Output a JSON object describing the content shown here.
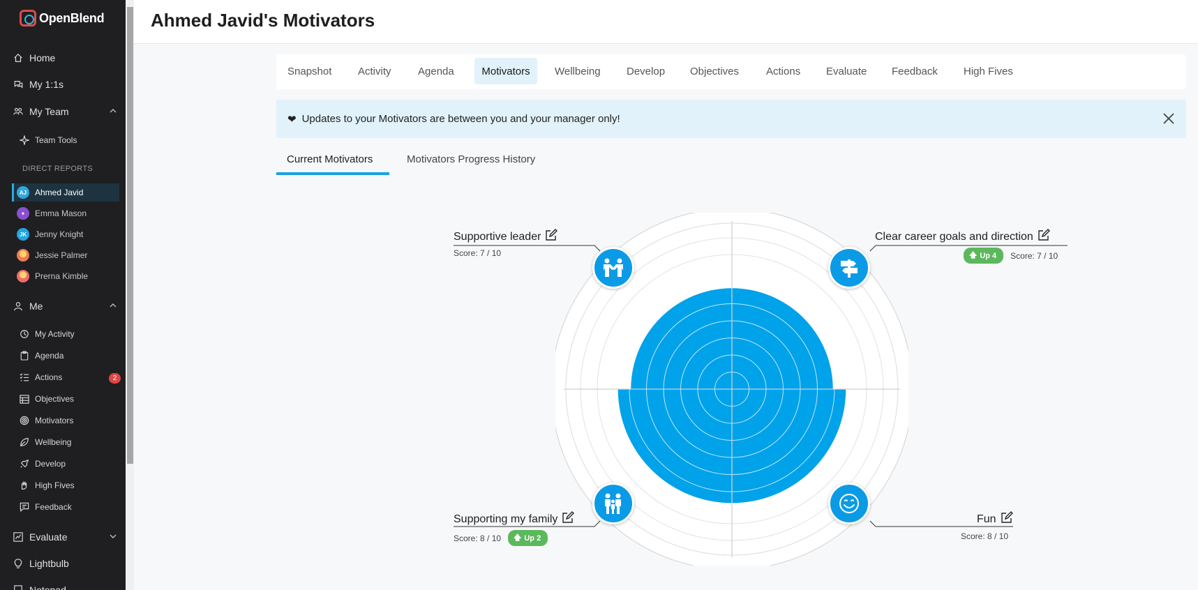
{
  "app": {
    "name": "OpenBlend"
  },
  "sidebar": {
    "home": "Home",
    "my_1_1s": "My 1:1s",
    "my_team": "My Team",
    "team_tools": "Team Tools",
    "direct_reports_label": "DIRECT REPORTS",
    "reports": [
      {
        "name": "Ahmed Javid",
        "initials": "AJ",
        "color": "#2fa8e0",
        "active": true
      },
      {
        "name": "Emma Mason",
        "initials": "",
        "color": "#8a4fd0",
        "active": false
      },
      {
        "name": "Jenny Knight",
        "initials": "JK",
        "color": "#20a6e6",
        "active": false
      },
      {
        "name": "Jessie Palmer",
        "initials": "",
        "color": "#f07a53",
        "active": false
      },
      {
        "name": "Prerna Kimble",
        "initials": "",
        "color": "#ef6c6c",
        "active": false
      }
    ],
    "me": "Me",
    "me_items": {
      "activity": "My Activity",
      "agenda": "Agenda",
      "actions": "Actions",
      "actions_count": "2",
      "objectives": "Objectives",
      "motivators": "Motivators",
      "wellbeing": "Wellbeing",
      "develop": "Develop",
      "high_fives": "High Fives",
      "feedback": "Feedback"
    },
    "evaluate": "Evaluate",
    "lightbulb": "Lightbulb",
    "notepad": "Notepad"
  },
  "header": {
    "title": "Ahmed Javid's Motivators"
  },
  "tabs": [
    "Snapshot",
    "Activity",
    "Agenda",
    "Motivators",
    "Wellbeing",
    "Develop",
    "Objectives",
    "Actions",
    "Evaluate",
    "Feedback",
    "High Fives"
  ],
  "active_tab": "Motivators",
  "alert": {
    "text": "Updates to your Motivators are between you and your manager only!"
  },
  "subtabs": {
    "current": "Current Motivators",
    "history": "Motivators Progress History"
  },
  "motivators": [
    {
      "label": "Supportive leader",
      "score": "Score: 7 / 10",
      "score_value": 7,
      "up": ""
    },
    {
      "label": "Clear career goals and direction",
      "score": "Score: 7 / 10",
      "score_value": 7,
      "up": "Up 4"
    },
    {
      "label": "Supporting my family",
      "score": "Score: 8 / 10",
      "score_value": 8,
      "up": "Up 2"
    },
    {
      "label": "Fun",
      "score": "Score: 8 / 10",
      "score_value": 8,
      "up": ""
    }
  ],
  "colors": {
    "accent": "#19a2e0",
    "fill": "#00a2ea",
    "up_badge": "#5cb85c"
  }
}
